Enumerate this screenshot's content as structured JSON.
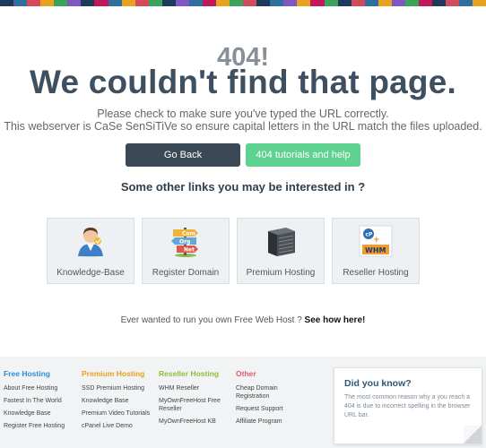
{
  "top_bar_colors": [
    "#1b3a5c",
    "#2f6f9f",
    "#d24a5b",
    "#e8a21e",
    "#3aa45a",
    "#7e57c2",
    "#1b3a5c",
    "#c2185b",
    "#2f6f9f",
    "#e8a21e",
    "#d24a5b",
    "#3aa45a",
    "#1b3a5c",
    "#7e57c2",
    "#2f6f9f",
    "#c2185b",
    "#e8a21e",
    "#3aa45a",
    "#d24a5b",
    "#1b3a5c",
    "#2f6f9f",
    "#7e57c2",
    "#e8a21e",
    "#c2185b",
    "#3aa45a",
    "#1b3a5c",
    "#d24a5b",
    "#2f6f9f",
    "#e8a21e",
    "#7e57c2",
    "#3aa45a",
    "#c2185b",
    "#1b3a5c",
    "#d24a5b",
    "#2f6f9f",
    "#e8a21e"
  ],
  "error": {
    "code": "404!",
    "headline": "We couldn't find that page.",
    "line1": "Please check to make sure you've typed the URL correctly.",
    "line2": "This webserver is CaSe SenSiTiVe so ensure capital letters in the URL match the files uploaded."
  },
  "buttons": {
    "back": "Go Back",
    "help": "404 tutorials and help"
  },
  "links_title": "Some other links you may be interested in ?",
  "tiles": [
    {
      "label": "Knowledge-Base",
      "icon": "support-agent-icon"
    },
    {
      "label": "Register Domain",
      "icon": "domain-signpost-icon"
    },
    {
      "label": "Premium Hosting",
      "icon": "server-icon"
    },
    {
      "label": "Reseller Hosting",
      "icon": "cpanel-whm-icon"
    }
  ],
  "signpost": {
    "sign1": "Com",
    "sign2": "Org",
    "sign3": "Net"
  },
  "cpanel_logo": {
    "top": "cP",
    "plus": "+",
    "bottom": "WHM"
  },
  "cta": {
    "text": "Ever wanted to run you own Free Web Host ?",
    "link": "See how here!"
  },
  "footer": {
    "free": {
      "title": "Free Hosting",
      "items": [
        "About Free Hosting",
        "Fastest In The World",
        "Knowledge Base",
        "Register Free Hosting"
      ]
    },
    "premium": {
      "title": "Premium Hosting",
      "items": [
        "SSD Premium Hosting",
        "Knowledge Base",
        "Premium Video Tutorials",
        "cPanel Live Demo"
      ]
    },
    "reseller": {
      "title": "Reseller Hosting",
      "items": [
        "WHM Reseller",
        "MyOwnFreeHost Free Reseller",
        "MyOwnFreeHost KB"
      ]
    },
    "other": {
      "title": "Other",
      "items": [
        "Cheap Domain Registration",
        "Request Support",
        "Affiliate Program"
      ]
    }
  },
  "did_you_know": {
    "title": "Did you know?",
    "text": "The most common reason why a you reach a 404 is due to incorrect spelling in the browser URL bar."
  }
}
